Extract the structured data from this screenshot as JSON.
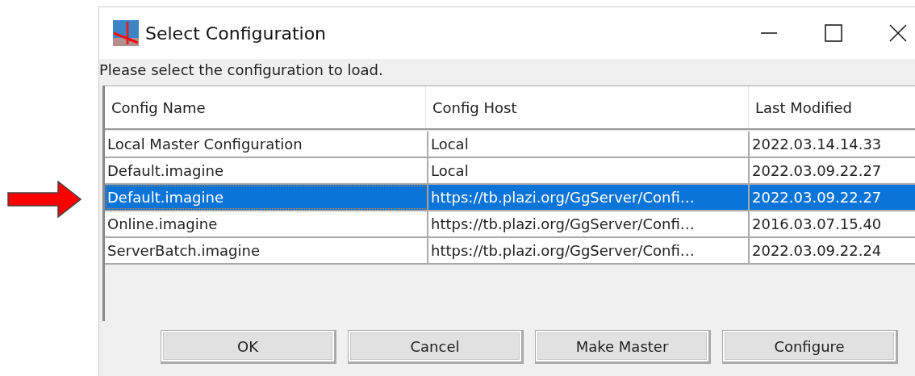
{
  "window": {
    "title": "Select Configuration"
  },
  "prompt": "Please select the configuration to load.",
  "table": {
    "columns": [
      "Config Name",
      "Config Host",
      "Last Modified"
    ],
    "rows": [
      {
        "cells": [
          "Local Master Configuration",
          "Local",
          "2022.03.14.14.33"
        ],
        "selected": false
      },
      {
        "cells": [
          "Default.imagine",
          "Local",
          "2022.03.09.22.27"
        ],
        "selected": false
      },
      {
        "cells": [
          "Default.imagine",
          "https://tb.plazi.org/GgServer/Confi…",
          "2022.03.09.22.27"
        ],
        "selected": true
      },
      {
        "cells": [
          "Online.imagine",
          "https://tb.plazi.org/GgServer/Confi…",
          "2016.03.07.15.40"
        ],
        "selected": false
      },
      {
        "cells": [
          "ServerBatch.imagine",
          "https://tb.plazi.org/GgServer/Confi…",
          "2022.03.09.22.24"
        ],
        "selected": false
      }
    ]
  },
  "buttons": [
    "OK",
    "Cancel",
    "Make Master",
    "Configure"
  ]
}
